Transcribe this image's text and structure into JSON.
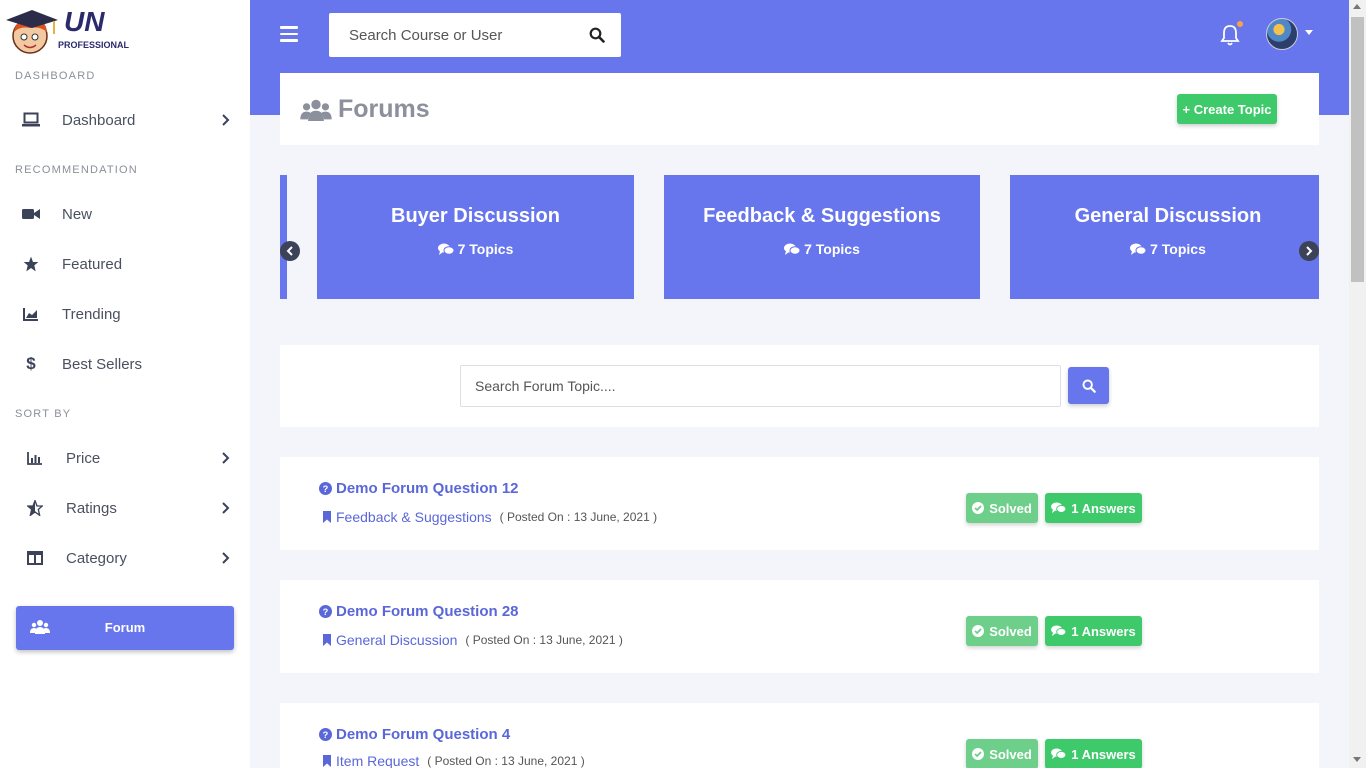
{
  "sidebar": {
    "logo": {
      "line1": "UN",
      "line2": "PROFESSIONAL"
    },
    "sections": {
      "dashboard": "DASHBOARD",
      "recommendation": "RECOMMENDATION",
      "sort_by": "SORT BY"
    },
    "items": {
      "dashboard": "Dashboard",
      "new": "New",
      "featured": "Featured",
      "trending": "Trending",
      "best_sellers": "Best Sellers",
      "price": "Price",
      "ratings": "Ratings",
      "category": "Category"
    },
    "forum_button": "Forum"
  },
  "header": {
    "search_placeholder": "Search Course or User",
    "has_notification": true
  },
  "forums": {
    "title": "Forums",
    "create_button": "+ Create Topic",
    "categories": [
      {
        "title": "Buyer Discussion",
        "topics": "7 Topics"
      },
      {
        "title": "Feedback & Suggestions",
        "topics": "7 Topics"
      },
      {
        "title": "General Discussion",
        "topics": "7 Topics"
      }
    ],
    "search_placeholder": "Search Forum Topic....",
    "topics": [
      {
        "question": "Demo Forum Question 12",
        "category": "Feedback & Suggestions",
        "posted": "( Posted On : 13 June, 2021 )",
        "status": "Solved",
        "answers": "1 Answers"
      },
      {
        "question": "Demo Forum Question 28",
        "category": "General Discussion",
        "posted": "( Posted On : 13 June, 2021 )",
        "status": "Solved",
        "answers": "1 Answers"
      },
      {
        "question": "Demo Forum Question 4",
        "category": "Item Request",
        "posted": "( Posted On : 13 June, 2021 )",
        "status": "Solved",
        "answers": "1 Answers"
      }
    ]
  },
  "colors": {
    "primary": "#6776ec",
    "success": "#3ec96a",
    "success_light": "#6dcf8a",
    "sidebar_bg": "#ffffff",
    "page_bg": "#f4f5fa"
  }
}
